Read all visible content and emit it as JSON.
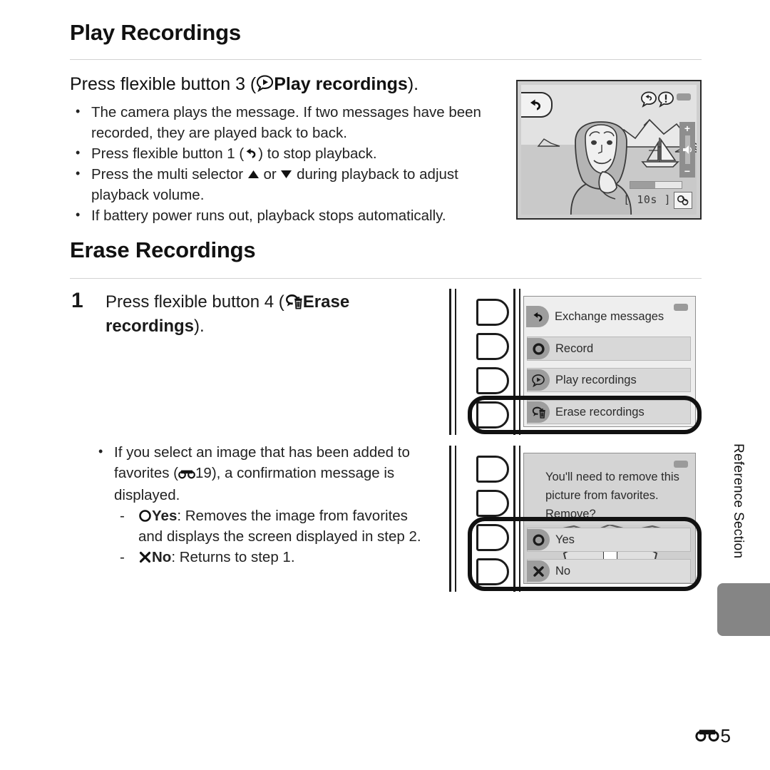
{
  "page": {
    "number_label": "5",
    "reference_symbol": "E-reference-glyph",
    "side_tab": "Reference Section"
  },
  "sections": [
    {
      "id": "play-recordings",
      "title": "Play Recordings",
      "subhead_prefix": "Press flexible button 3 (",
      "subhead_icon": "play-recordings-icon",
      "subhead_bold": "Play recordings",
      "subhead_suffix": ").",
      "bullets": [
        {
          "text_a": "The camera plays the message. If two messages have been recorded, they are played back to back."
        },
        {
          "text_a": "Press flexible button 1 (",
          "icon": "back-arrow-icon",
          "text_b": ") to stop playback."
        },
        {
          "text_a": "Press the multi selector ",
          "icon": "up-triangle-icon",
          "text_b": " or ",
          "icon2": "down-triangle-icon",
          "text_c": " during playback to adjust playback volume."
        },
        {
          "text_a": "If battery power runs out, playback stops automatically."
        }
      ]
    },
    {
      "id": "erase-recordings",
      "title": "Erase Recordings",
      "step_number": "1",
      "step_prefix": "Press flexible button 4 (",
      "step_icon": "erase-recordings-icon",
      "step_bold": "Erase recordings",
      "step_suffix": ").",
      "bullets": [
        {
          "text_a": "If you select an image that has been added to favorites (",
          "icon": "E-reference-glyph",
          "ref_page": "19",
          "text_b": "), a confirmation message is displayed."
        }
      ],
      "dash_items": [
        {
          "icon": "yes-circle-icon",
          "bold": "Yes",
          "text": ": Removes the image from favorites and displays the screen displayed in step 2."
        },
        {
          "icon": "no-cross-icon",
          "bold": "No",
          "text": ": Returns to step 1."
        }
      ]
    }
  ],
  "playback_screen": {
    "name": "camera-playback-screen",
    "back_button_icon": "back-arrow-icon",
    "status_icons": [
      "message-back-bubble-icon",
      "message-alert-bubble-icon"
    ],
    "battery_icon": "battery-indicator",
    "volume": {
      "plus": "+",
      "speaker_icon": "speaker-icon",
      "minus": "−"
    },
    "timer_label": "[ 10s ]",
    "attachment_icon": "voice-memo-icon",
    "subject_illustration": "woman-portrait-with-sailboat-and-mountains"
  },
  "menu_screen_1": {
    "name": "voice-message-menu",
    "flexible_buttons": [
      "flexible-button-1",
      "flexible-button-2",
      "flexible-button-3",
      "flexible-button-4"
    ],
    "battery_icon": "battery-indicator",
    "items": [
      {
        "label": "Exchange messages",
        "icon": "back-arrow-icon",
        "highlighted": false
      },
      {
        "label": "Record",
        "icon": "record-circle-icon",
        "highlighted": false
      },
      {
        "label": "Play recordings",
        "icon": "play-recordings-icon",
        "highlighted": false
      },
      {
        "label": "Erase recordings",
        "icon": "erase-recordings-icon",
        "highlighted": true
      }
    ]
  },
  "menu_screen_2": {
    "name": "remove-from-favorites-confirmation",
    "battery_icon": "battery-indicator",
    "message_line_1": "You'll need to remove this",
    "message_line_2": "picture from favorites.",
    "message_line_3": "Remove?",
    "options": [
      {
        "label": "Yes",
        "icon": "yes-circle-icon",
        "highlighted": true
      },
      {
        "label": "No",
        "icon": "no-cross-icon",
        "highlighted": true
      }
    ]
  },
  "colors": {
    "text": "#1a1a1a",
    "rule": "#d2d2d2",
    "menu_row": "#d8d8d8",
    "highlight_border": "#111111",
    "tab_gray": "#858585"
  }
}
